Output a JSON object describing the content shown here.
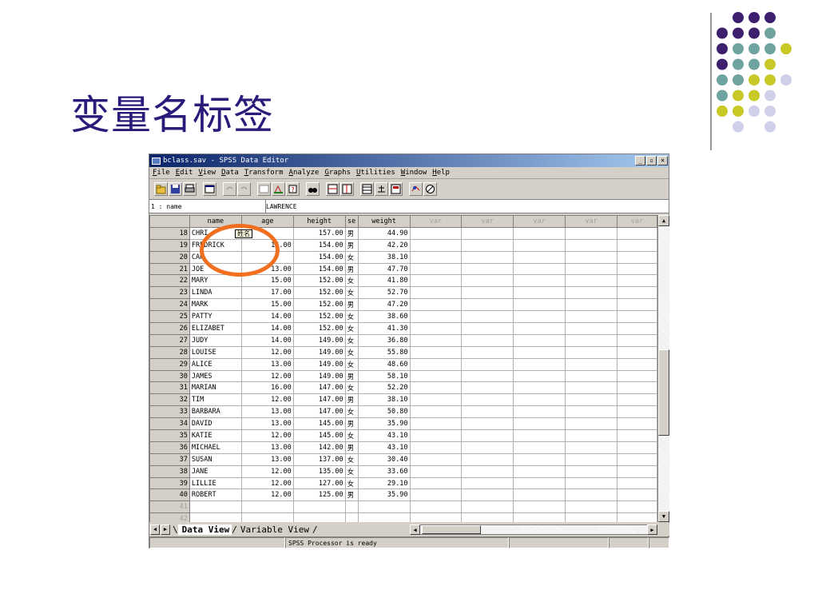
{
  "slide": {
    "title": "变量名标签"
  },
  "window": {
    "title": "bclass.sav - SPSS Data Editor",
    "controls": [
      "_",
      "▫",
      "×"
    ]
  },
  "menu": [
    {
      "key": "F",
      "rest": "ile"
    },
    {
      "key": "E",
      "rest": "dit"
    },
    {
      "key": "V",
      "rest": "iew"
    },
    {
      "key": "D",
      "rest": "ata"
    },
    {
      "key": "T",
      "rest": "ransform"
    },
    {
      "key": "A",
      "rest": "nalyze"
    },
    {
      "key": "G",
      "rest": "raphs"
    },
    {
      "key": "U",
      "rest": "tilities"
    },
    {
      "key": "W",
      "rest": "indow"
    },
    {
      "key": "H",
      "rest": "elp"
    }
  ],
  "toolbar": [
    "open-icon",
    "save-icon",
    "print-icon",
    "dialog-recall-icon",
    "undo-icon",
    "redo-icon",
    "goto-chart-icon",
    "goto-case-icon",
    "variables-icon",
    "find-icon",
    "insert-case-icon",
    "insert-variable-icon",
    "split-file-icon",
    "weight-cases-icon",
    "select-cases-icon",
    "value-labels-icon",
    "use-sets-icon"
  ],
  "cell_editor": {
    "ref": "1 : name",
    "value": "LAWRENCE"
  },
  "grid": {
    "columns": [
      "name",
      "age",
      "height",
      "se",
      "weight",
      "var",
      "var",
      "var",
      "var",
      "var"
    ],
    "rows": [
      {
        "n": "18",
        "name": "CHRI",
        "age": "",
        "height": "157.00",
        "sex": "男",
        "weight": "44.90"
      },
      {
        "n": "19",
        "name": "FREDRICK",
        "age": "14.00",
        "height": "154.00",
        "sex": "男",
        "weight": "42.20"
      },
      {
        "n": "20",
        "name": "CAR",
        "age": "",
        "height": "154.00",
        "sex": "女",
        "weight": "38.10"
      },
      {
        "n": "21",
        "name": "JOE",
        "age": "13.00",
        "height": "154.00",
        "sex": "男",
        "weight": "47.70"
      },
      {
        "n": "22",
        "name": "MARY",
        "age": "15.00",
        "height": "152.00",
        "sex": "女",
        "weight": "41.80"
      },
      {
        "n": "23",
        "name": "LINDA",
        "age": "17.00",
        "height": "152.00",
        "sex": "女",
        "weight": "52.70"
      },
      {
        "n": "24",
        "name": "MARK",
        "age": "15.00",
        "height": "152.00",
        "sex": "男",
        "weight": "47.20"
      },
      {
        "n": "25",
        "name": "PATTY",
        "age": "14.00",
        "height": "152.00",
        "sex": "女",
        "weight": "38.60"
      },
      {
        "n": "26",
        "name": "ELIZABET",
        "age": "14.00",
        "height": "152.00",
        "sex": "女",
        "weight": "41.30"
      },
      {
        "n": "27",
        "name": "JUDY",
        "age": "14.00",
        "height": "149.00",
        "sex": "女",
        "weight": "36.80"
      },
      {
        "n": "28",
        "name": "LOUISE",
        "age": "12.00",
        "height": "149.00",
        "sex": "女",
        "weight": "55.80"
      },
      {
        "n": "29",
        "name": "ALICE",
        "age": "13.00",
        "height": "149.00",
        "sex": "女",
        "weight": "48.60"
      },
      {
        "n": "30",
        "name": "JAMES",
        "age": "12.00",
        "height": "149.00",
        "sex": "男",
        "weight": "58.10"
      },
      {
        "n": "31",
        "name": "MARIAN",
        "age": "16.00",
        "height": "147.00",
        "sex": "女",
        "weight": "52.20"
      },
      {
        "n": "32",
        "name": "TIM",
        "age": "12.00",
        "height": "147.00",
        "sex": "男",
        "weight": "38.10"
      },
      {
        "n": "33",
        "name": "BARBARA",
        "age": "13.00",
        "height": "147.00",
        "sex": "女",
        "weight": "50.80"
      },
      {
        "n": "34",
        "name": "DAVID",
        "age": "13.00",
        "height": "145.00",
        "sex": "男",
        "weight": "35.90"
      },
      {
        "n": "35",
        "name": "KATIE",
        "age": "12.00",
        "height": "145.00",
        "sex": "女",
        "weight": "43.10"
      },
      {
        "n": "36",
        "name": "MICHAEL",
        "age": "13.00",
        "height": "142.00",
        "sex": "男",
        "weight": "43.10"
      },
      {
        "n": "37",
        "name": "SUSAN",
        "age": "13.00",
        "height": "137.00",
        "sex": "女",
        "weight": "30.40"
      },
      {
        "n": "38",
        "name": "JANE",
        "age": "12.00",
        "height": "135.00",
        "sex": "女",
        "weight": "33.60"
      },
      {
        "n": "39",
        "name": "LILLIE",
        "age": "12.00",
        "height": "127.00",
        "sex": "女",
        "weight": "29.10"
      },
      {
        "n": "40",
        "name": "ROBERT",
        "age": "12.00",
        "height": "125.00",
        "sex": "男",
        "weight": "35.90"
      },
      {
        "n": "41",
        "name": "",
        "age": "",
        "height": "",
        "sex": "",
        "weight": ""
      },
      {
        "n": "42",
        "name": "",
        "age": "",
        "height": "",
        "sex": "",
        "weight": ""
      }
    ]
  },
  "tooltip": "姓名",
  "tabs": {
    "active": "Data View",
    "inactive": "Variable View"
  },
  "status": {
    "processor": "SPSS Processor  is ready"
  },
  "colors": {
    "accent": "#f07020",
    "title": "#2c1a7a",
    "dot_purple": "#3d1f6e",
    "dot_teal": "#6fa3a0",
    "dot_yellow": "#c8c828",
    "dot_lavender": "#d0d0e8"
  }
}
